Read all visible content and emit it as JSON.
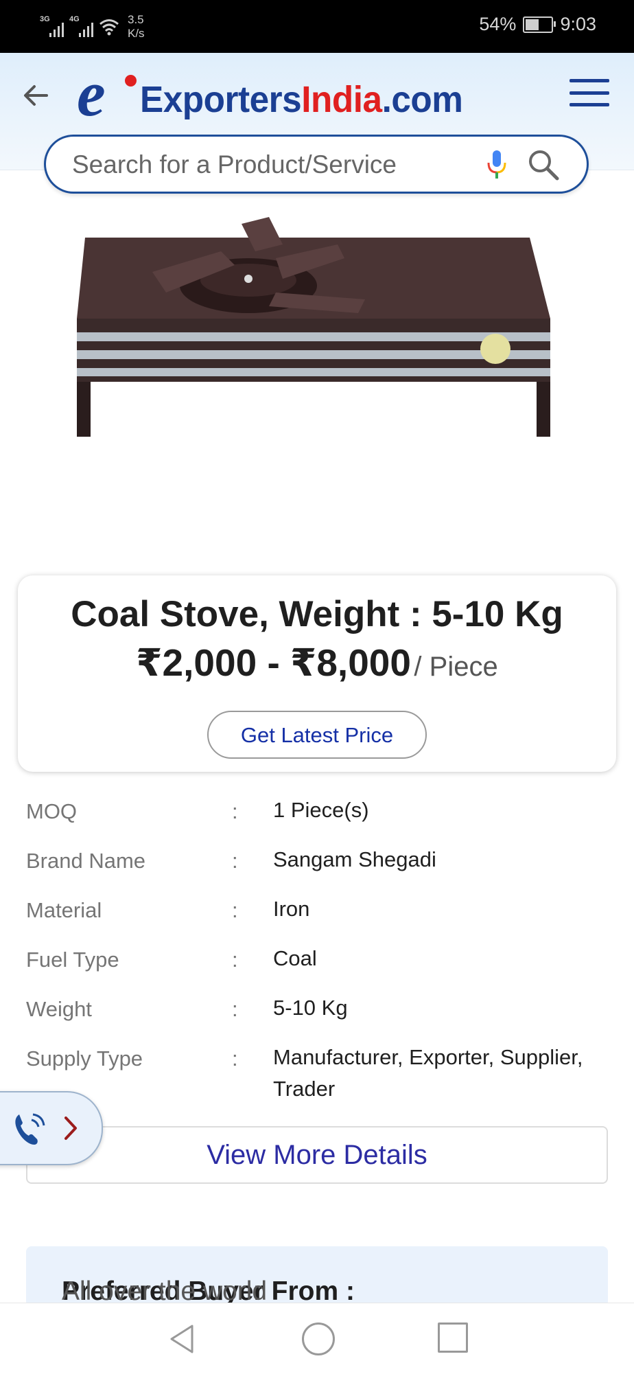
{
  "status_bar": {
    "signal1_label": "3G",
    "signal2_label": "4G",
    "speed_value": "3.5",
    "speed_unit": "K/s",
    "battery": "54%",
    "battery_level": 0.54,
    "time": "9:03"
  },
  "header": {
    "logo_e": "e",
    "logo_part1": "Exporters",
    "logo_part2": "India",
    "logo_part3": ".com",
    "brand_colors": {
      "blue": "#1b3f93",
      "red": "#e02020"
    }
  },
  "search": {
    "placeholder": "Search for a Product/Service",
    "icons": [
      "mic-icon",
      "search-icon"
    ]
  },
  "product": {
    "image_subject": "coal-stove-photo",
    "title": "Coal Stove, Weight : 5-10 Kg",
    "price": "₹2,000 - ₹8,000",
    "price_unit": "/ Piece",
    "cta_label": "Get Latest Price"
  },
  "specs": [
    {
      "label": "MOQ",
      "sep": ":",
      "value": "1 Piece(s)"
    },
    {
      "label": "Brand Name",
      "sep": ":",
      "value": "Sangam Shegadi"
    },
    {
      "label": "Material",
      "sep": ":",
      "value": "Iron"
    },
    {
      "label": "Fuel Type",
      "sep": ":",
      "value": "Coal"
    },
    {
      "label": "Weight",
      "sep": ":",
      "value": "5-10 Kg"
    },
    {
      "label": "Supply Type",
      "sep": ":",
      "value": "Manufacturer, Exporter, Supplier, Trader"
    }
  ],
  "view_more_label": "View More Details",
  "buyer": {
    "label": "Preferred Buyer From :",
    "value": "All over the world"
  },
  "nav_bar": {
    "icons": [
      "back-icon",
      "home-icon",
      "recents-icon"
    ]
  }
}
